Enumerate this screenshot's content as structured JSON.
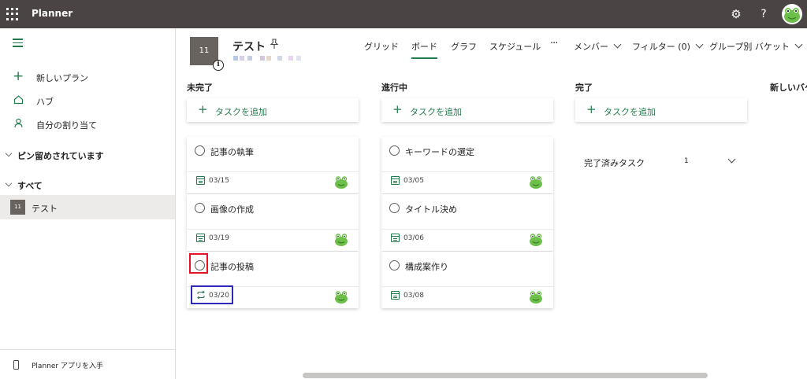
{
  "app": {
    "title": "Planner"
  },
  "topbar": {
    "settings_icon": "gear-icon",
    "help_label": "?",
    "avatar": "frog-avatar"
  },
  "sidebar": {
    "items": [
      {
        "label": "新しいプラン",
        "icon": "plus-icon"
      },
      {
        "label": "ハブ",
        "icon": "home-icon"
      },
      {
        "label": "自分の割り当て",
        "icon": "person-icon"
      }
    ],
    "pinned_label": "ピン留めされています",
    "all_label": "すべて",
    "plans": [
      {
        "tile": "11",
        "label": "テスト"
      }
    ],
    "footer_label": "Planner アプリを入手"
  },
  "plan": {
    "tile": "11",
    "info_badge": "i",
    "title": "テスト"
  },
  "views": {
    "tabs": [
      {
        "label": "グリッド",
        "active": false
      },
      {
        "label": "ボード",
        "active": true
      },
      {
        "label": "グラフ",
        "active": false
      },
      {
        "label": "スケジュール",
        "active": false
      }
    ],
    "more_label": "···",
    "members_label": "メンバー",
    "filter_label": "フィルター (0)",
    "group_label": "グループ別 バケット"
  },
  "board": {
    "add_task_label": "タスクを追加",
    "buckets": [
      {
        "title": "未完了",
        "tasks": [
          {
            "title": "記事の執筆",
            "date": "03/15",
            "icon": "calendar-icon"
          },
          {
            "title": "画像の作成",
            "date": "03/19",
            "icon": "calendar-icon"
          },
          {
            "title": "記事の投稿",
            "date": "03/20",
            "icon": "repeat-icon"
          }
        ]
      },
      {
        "title": "進行中",
        "tasks": [
          {
            "title": "キーワードの選定",
            "date": "03/05",
            "icon": "calendar-icon"
          },
          {
            "title": "タイトル決め",
            "date": "03/06",
            "icon": "calendar-icon"
          },
          {
            "title": "構成案作り",
            "date": "03/08",
            "icon": "calendar-icon"
          }
        ]
      },
      {
        "title": "完了",
        "completed_label": "完了済みタスク",
        "completed_count": "1"
      }
    ],
    "new_bucket_label": "新しいバケット"
  },
  "colors": {
    "topbar": "#4a4544",
    "accent": "#237b4b",
    "highlight_red": "#e81123",
    "highlight_blue": "#2b2bb8"
  }
}
